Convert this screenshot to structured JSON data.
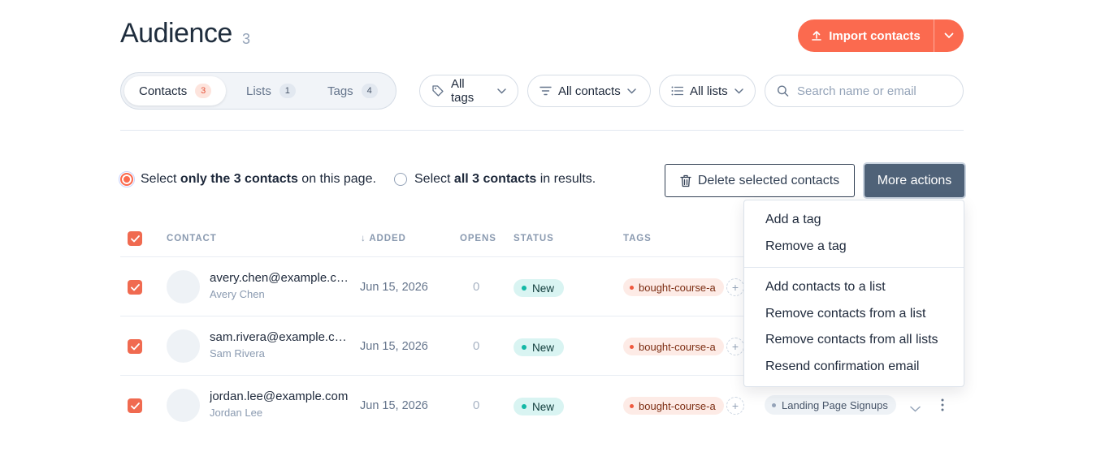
{
  "header": {
    "title": "Audience",
    "count": "3",
    "import_label": "Import contacts"
  },
  "tabs": [
    {
      "label": "Contacts",
      "count": "3",
      "active": true
    },
    {
      "label": "Lists",
      "count": "1",
      "active": false
    },
    {
      "label": "Tags",
      "count": "4",
      "active": false
    }
  ],
  "filters": {
    "tags": "All tags",
    "contacts": "All contacts",
    "lists": "All lists",
    "search_placeholder": "Search name or email"
  },
  "selection": {
    "page_prefix": "Select",
    "page_bold": "only the 3 contacts",
    "page_suffix": "on this page.",
    "all_prefix": "Select",
    "all_bold": "all 3 contacts",
    "all_suffix": "in results.",
    "page_selected": true
  },
  "actions": {
    "delete_label": "Delete selected contacts",
    "more_label": "More actions"
  },
  "table": {
    "columns": [
      "CONTACT",
      "ADDED",
      "OPENS",
      "STATUS",
      "TAGS"
    ],
    "sort_indicator": "↓",
    "rows": [
      {
        "email": "avery.chen@example.com",
        "name": "Avery Chen",
        "added": "Jun 15, 2026",
        "opens": "0",
        "status": "New",
        "tag": "bought-course-a",
        "checked": true
      },
      {
        "email": "sam.rivera@example.com",
        "name": "Sam Rivera",
        "added": "Jun 15, 2026",
        "opens": "0",
        "status": "New",
        "tag": "bought-course-a",
        "checked": true
      },
      {
        "email": "jordan.lee@example.com",
        "name": "Jordan Lee",
        "added": "Jun 15, 2026",
        "opens": "0",
        "status": "New",
        "tag": "bought-course-a",
        "list": "Landing Page Signups",
        "checked": true
      }
    ]
  },
  "menu": {
    "items": [
      "Add a tag",
      "Remove a tag",
      "Add contacts to a list",
      "Remove contacts from a list",
      "Remove contacts from all lists",
      "Resend confirmation email"
    ]
  },
  "colors": {
    "accent": "#fb6a4f",
    "more_actions_bg": "#4f6278",
    "status_bg": "#d9f4f2",
    "tag_bg": "#fdebe6"
  }
}
